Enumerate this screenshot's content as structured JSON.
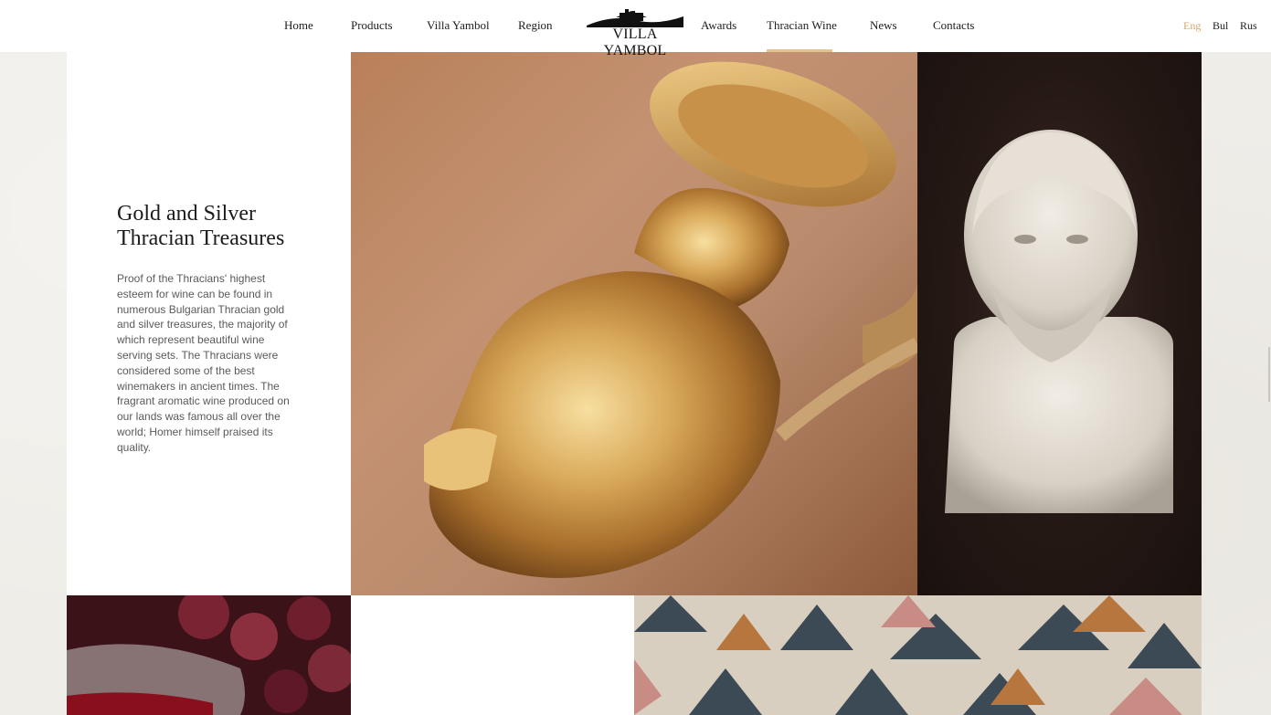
{
  "header": {
    "logo_text": "VILLA YAMBOL",
    "nav_left": [
      {
        "label": "Home"
      },
      {
        "label": "Products"
      },
      {
        "label": "Villa Yambol"
      },
      {
        "label": "Region"
      }
    ],
    "nav_right": [
      {
        "label": "Awards"
      },
      {
        "label": "Thracian Wine",
        "active": true
      },
      {
        "label": "News"
      },
      {
        "label": "Contacts"
      }
    ],
    "languages": [
      {
        "label": "Eng",
        "active": true
      },
      {
        "label": "Bul"
      },
      {
        "label": "Rus"
      }
    ]
  },
  "section": {
    "title_line1": "Gold and Silver",
    "title_line2": "Thracian Treasures",
    "body": "Proof of the Thracians' highest esteem for wine can be found in numerous Bulgarian Thracian gold and silver treasures, the majority of which represent beautiful wine serving sets. The Thracians were considered some of the best winemakers in ancient times. The fragrant aromatic wine produced on our lands was famous all over the world; Homer himself praised its quality."
  },
  "colors": {
    "accent": "#e5c48c",
    "lang_active": "#d7a86a",
    "background": "#efede8"
  }
}
